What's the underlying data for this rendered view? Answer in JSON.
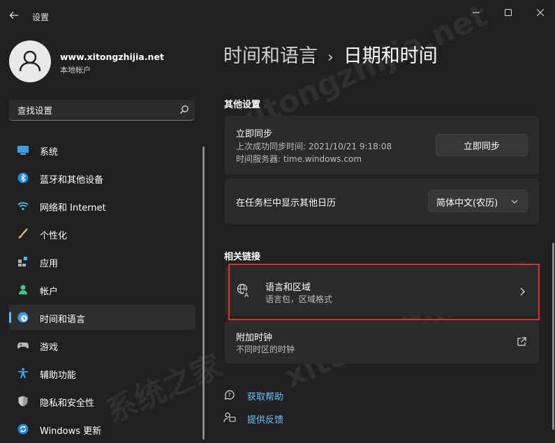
{
  "window": {
    "title": "设置"
  },
  "profile": {
    "name": "www.xitongzhijia.net",
    "account_type": "本地帐户"
  },
  "search": {
    "placeholder": "查找设置"
  },
  "sidebar": {
    "items": [
      {
        "label": "系统",
        "icon": "monitor-icon"
      },
      {
        "label": "蓝牙和其他设备",
        "icon": "bluetooth-icon"
      },
      {
        "label": "网络和 Internet",
        "icon": "wifi-icon"
      },
      {
        "label": "个性化",
        "icon": "brush-icon"
      },
      {
        "label": "应用",
        "icon": "apps-icon"
      },
      {
        "label": "帐户",
        "icon": "person-icon"
      },
      {
        "label": "时间和语言",
        "icon": "clock-globe-icon",
        "active": true
      },
      {
        "label": "游戏",
        "icon": "gamepad-icon"
      },
      {
        "label": "辅助功能",
        "icon": "accessibility-icon"
      },
      {
        "label": "隐私和安全性",
        "icon": "shield-icon"
      },
      {
        "label": "Windows 更新",
        "icon": "update-icon"
      }
    ]
  },
  "breadcrumb": {
    "parent": "时间和语言",
    "separator": "›",
    "current": "日期和时间"
  },
  "other_settings": {
    "heading": "其他设置",
    "sync": {
      "title": "立即同步",
      "last_sync": "上次成功同步时间: 2021/10/21 9:18:08",
      "time_server": "时间服务器: time.windows.com",
      "button_label": "立即同步"
    },
    "calendar": {
      "label": "在任务栏中显示其他日历",
      "selected": "简体中文(农历)"
    }
  },
  "related_links": {
    "heading": "相关链接",
    "language_region": {
      "title": "语言和区域",
      "subtitle": "语言包，区域格式"
    },
    "additional_clocks": {
      "title": "附加时钟",
      "subtitle": "不同时区的时钟"
    }
  },
  "help": {
    "get_help": "获取帮助",
    "feedback": "提供反馈"
  },
  "watermark": {
    "text": "xitongzhijia.net",
    "text2": "系统之家"
  },
  "colors": {
    "accent": "#4cc2ff",
    "link": "#63c7ff",
    "highlight": "#e0302b",
    "background": "#202020",
    "card": "#2b2b2b"
  }
}
